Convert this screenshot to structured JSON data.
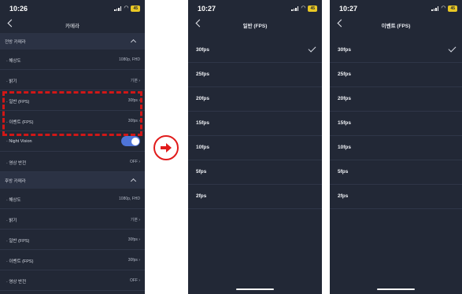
{
  "left_screen": {
    "time": "10:26",
    "battery": "45",
    "title": "카메라",
    "front_section": "전방 카메라",
    "front_rows": [
      {
        "label": "· 해상도",
        "value": "1080p, FHD"
      },
      {
        "label": "· 밝기",
        "value": "기본 ›"
      },
      {
        "label": "· 일반 (FPS)",
        "value": "30fps ›"
      },
      {
        "label": "· 이벤트 (FPS)",
        "value": "30fps ›"
      },
      {
        "label": "· Night Vision",
        "value": ""
      },
      {
        "label": "· 영상 반전",
        "value": "OFF ›"
      }
    ],
    "night_vision_on": true,
    "rear_section": "후방 카메라",
    "rear_rows": [
      {
        "label": "· 해상도",
        "value": "1080p, FHD"
      },
      {
        "label": "· 밝기",
        "value": "기본 ›"
      },
      {
        "label": "· 일반 (FPS)",
        "value": "30fps ›"
      },
      {
        "label": "· 이벤트 (FPS)",
        "value": "30fps ›"
      },
      {
        "label": "· 영상 반전",
        "value": "OFF ›"
      }
    ]
  },
  "middle_screen": {
    "time": "10:27",
    "battery": "45",
    "title": "일반 (FPS)",
    "options": [
      "30fps",
      "25fps",
      "20fps",
      "15fps",
      "10fps",
      "5fps",
      "2fps"
    ],
    "selected": "30fps"
  },
  "right_screen": {
    "time": "10:27",
    "battery": "45",
    "title": "이벤트 (FPS)",
    "options": [
      "30fps",
      "25fps",
      "20fps",
      "15fps",
      "10fps",
      "5fps",
      "2fps"
    ],
    "selected": "30fps"
  },
  "colors": {
    "background": "#222836",
    "section": "#2b3244",
    "toggle": "#4e74d8",
    "highlight": "#d11717",
    "battery": "#e9c825"
  }
}
